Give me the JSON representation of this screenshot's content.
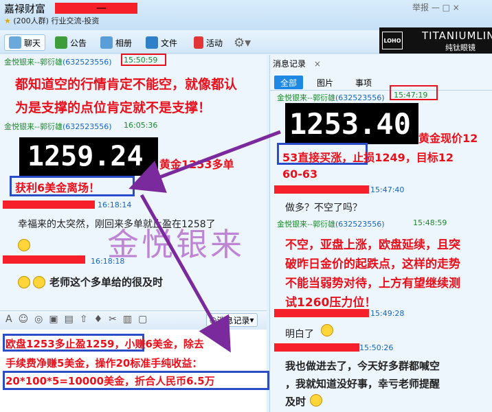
{
  "window": {
    "title_prefix": "嘉禄财富",
    "subtitle": "(200人群) 行业交流-投资",
    "controls": "举报 — □ ×"
  },
  "toolbar": {
    "chat": "聊天",
    "notice": "公告",
    "album": "相册",
    "files": "文件",
    "activity": "活动"
  },
  "ad": {
    "logo": "LOHO",
    "brand": "TITANIUMLIN",
    "brand_cn": "纯钛眼镜"
  },
  "left_chat": {
    "m1": {
      "sender": "金悦银来--郭衍雄",
      "qq": "(632523556)",
      "time": "15:50:59",
      "text1": "都知道空的行情肯定不能空，就像都认",
      "text2": "为是支撑的点位肯定就不是支撑！"
    },
    "m2": {
      "sender": "金悦银来--郭衍雄",
      "qq": "(632523556)",
      "time": "16:05:36",
      "price": "1259.24",
      "text1": "黄金1253多单",
      "text2": "获利6美金离场！"
    },
    "m3": {
      "time": "16:18:14",
      "text": "幸福来的太突然，刚回来多单就止盈在1258了"
    },
    "m4": {
      "time": "16:18:18",
      "text": "老师这个多单给的很及时"
    }
  },
  "watermark": "金悦银来",
  "input": {
    "history_label": "消息记录",
    "line1": "欧盘1253多止盈1259，小赚6美金，除去",
    "line2": "手续费净赚5美金，操作20标准手纯收益：",
    "line3": "20*100*5=10000美金，折合人民币6.5万"
  },
  "right_panel": {
    "header": "消息记录",
    "tabs": [
      "全部",
      "图片",
      "事项"
    ],
    "r1": {
      "sender": "金悦银来--郭衍雄",
      "qq": "(632523556)",
      "time": "15:47:19",
      "price": "1253.40",
      "text1": "黄金现价12",
      "text2": "53直接买涨，止损1249，目标12",
      "text3": "60-63"
    },
    "r2": {
      "time": "15:47:40",
      "text": "做多？不空了吗？"
    },
    "r3": {
      "sender": "金悦银来--郭衍雄",
      "qq": "(632523556)",
      "time": "15:48:59",
      "text1": "不空，亚盘上涨，欧盘延续，且突",
      "text2": "破昨日金价的起跌点，这样的走势",
      "text3": "不能当弱势对待，上方有望继续测",
      "text4": "试1260压力位！"
    },
    "r4": {
      "time": "15:49:28",
      "text": "明白了"
    },
    "r5": {
      "time": "15:50:26",
      "text1": "我也做进去了，今天好多群都喊空",
      "text2": "，我就知道没好事，幸亏老师提醒",
      "text3": "及时"
    }
  },
  "colors": {
    "accent_red": "#e8101b",
    "accent_blue": "#2a4cc8",
    "arrow": "#7a2a9c",
    "sender_green": "#1a8a2a"
  }
}
